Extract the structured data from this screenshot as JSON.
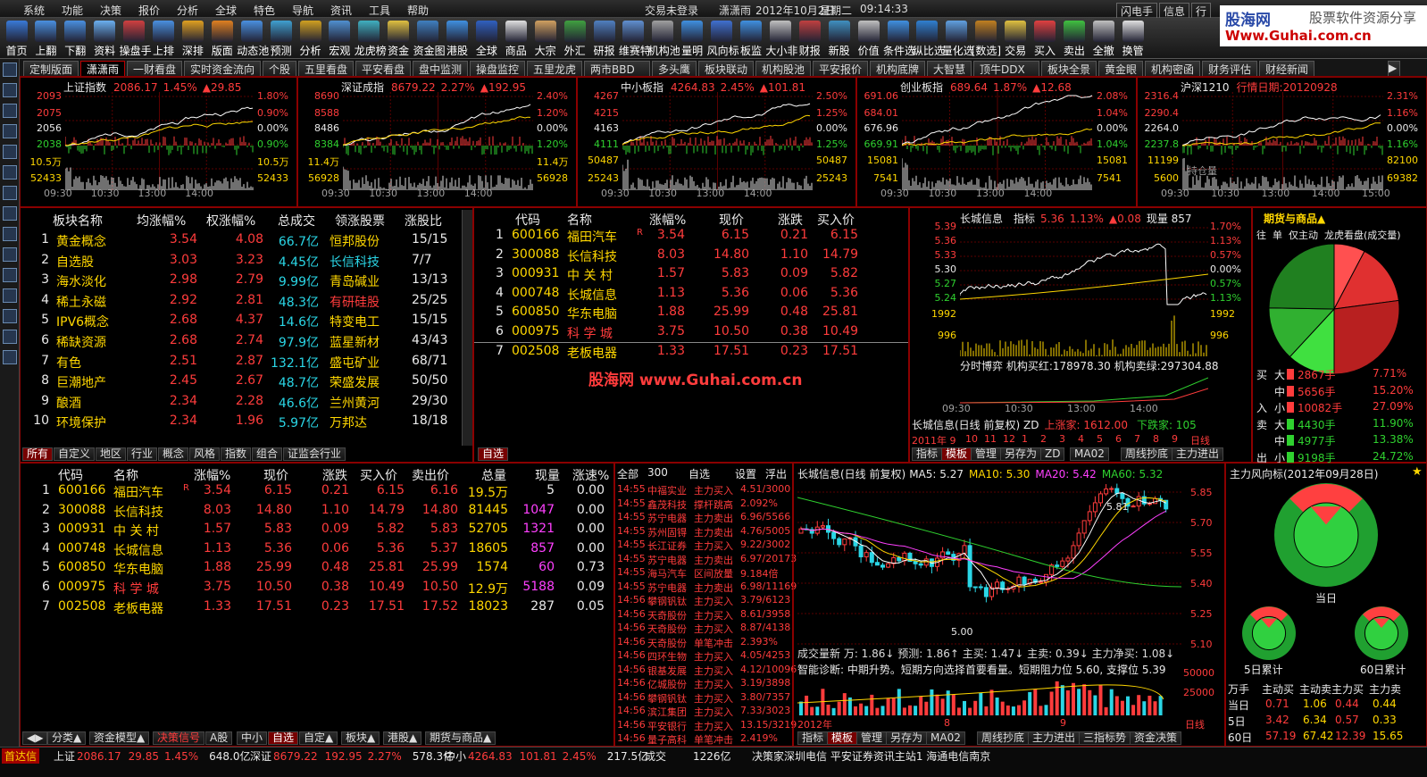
{
  "menu": {
    "items": [
      "系统",
      "功能",
      "决策",
      "报价",
      "分析",
      "全球",
      "特色",
      "导航",
      "资讯",
      "工具",
      "帮助"
    ],
    "login": "交易未登录",
    "user": "潇潇雨",
    "date": "2012年10月2日",
    "weekday": "星期二",
    "time": "09:14:33",
    "right": [
      "闪电手",
      "信息",
      "行"
    ]
  },
  "logo": {
    "t1": "股海网",
    "t2": "股票软件资源分享",
    "t3": "Www.Guhai.com.cn"
  },
  "toolbar": [
    {
      "l": "首页",
      "c": "#3a7ad8"
    },
    {
      "l": "上翻",
      "c": "#4a90e0"
    },
    {
      "l": "下翻",
      "c": "#4a90e0"
    },
    {
      "l": "资料",
      "c": "#6ab0f0"
    },
    {
      "l": "操盘手",
      "c": "#d04040"
    },
    {
      "l": "上排",
      "c": "#4a90e0"
    },
    {
      "l": "深排",
      "c": "#e0a020"
    },
    {
      "l": "版面",
      "c": "#e08020"
    },
    {
      "l": "动态池",
      "c": "#4a90e0"
    },
    {
      "l": "预测",
      "c": "#40a0d0"
    },
    {
      "l": "分析",
      "c": "#d0a020"
    },
    {
      "l": "宏观",
      "c": "#5090d0"
    },
    {
      "l": "龙虎榜",
      "c": "#40b0c0"
    },
    {
      "l": "资金",
      "c": "#e0c040"
    },
    {
      "l": "资金图",
      "c": "#4080c0"
    },
    {
      "l": "港股",
      "c": "#4090e0"
    },
    {
      "l": "全球",
      "c": "#3060c0"
    },
    {
      "l": "商品",
      "c": "#e0e0e0"
    },
    {
      "l": "大宗",
      "c": "#d0a060"
    },
    {
      "l": "外汇",
      "c": "#40a040"
    },
    {
      "l": "研报",
      "c": "#5080c0"
    },
    {
      "l": "维赛特",
      "c": "#6090d0"
    },
    {
      "l": "机构池",
      "c": "#a0a0a0"
    },
    {
      "l": "量明",
      "c": "#4090e0"
    },
    {
      "l": "风向标",
      "c": "#4070d0"
    },
    {
      "l": "板监",
      "c": "#4090e0"
    },
    {
      "l": "大小非",
      "c": "#c0c0c0"
    },
    {
      "l": "财报",
      "c": "#c04040"
    },
    {
      "l": "新股",
      "c": "#4090c0"
    },
    {
      "l": "价值",
      "c": "#c0c0c0"
    },
    {
      "l": "条件选",
      "c": "#4090e0"
    },
    {
      "l": "纵比选",
      "c": "#3080d0"
    },
    {
      "l": "量化选",
      "c": "#60a0e0"
    },
    {
      "l": "[数选]",
      "c": "#c08020"
    },
    {
      "l": "交易",
      "c": "#e0c040"
    },
    {
      "l": "买入",
      "c": "#e04040"
    },
    {
      "l": "卖出",
      "c": "#40c040"
    },
    {
      "l": "全撤",
      "c": "#c0c0c0"
    },
    {
      "l": "换管",
      "c": "#e0e0e0"
    }
  ],
  "tabs": [
    "定制版面",
    "潇潇雨",
    "一财看盘",
    "实时资金流向",
    "个股",
    "五里看盘",
    "平安看盘",
    "盘中监测",
    "操盘监控",
    "五里龙虎",
    "两市BBD",
    "多头鹰",
    "板块联动",
    "机构股池",
    "平安报价",
    "机构底牌",
    "大智慧",
    "顶牛DDX",
    "板块全景",
    "黄金眼",
    "机构密函",
    "财务评估",
    "财经新闻"
  ],
  "minis": [
    {
      "name": "上证指数",
      "v1": "2086.17",
      "v2": "1.45%",
      "v3": "▲29.85",
      "left": [
        "2093",
        "2075",
        "2056",
        "2038",
        "10.5万",
        "52433"
      ],
      "right": [
        "1.80%",
        "0.90%",
        "0.00%",
        "0.90%",
        "10.5万",
        "52433"
      ],
      "times": [
        "09:30",
        "10:30",
        "13:00",
        "14:00"
      ]
    },
    {
      "name": "深证成指",
      "v1": "8679.22",
      "v2": "2.27%",
      "v3": "▲192.95",
      "left": [
        "8690",
        "8588",
        "8486",
        "8384",
        "11.4万",
        "56928"
      ],
      "right": [
        "2.40%",
        "1.20%",
        "0.00%",
        "1.20%",
        "11.4万",
        "56928"
      ],
      "times": [
        "09:30",
        "10:30",
        "13:00",
        "14:00"
      ]
    },
    {
      "name": "中小板指",
      "v1": "4264.83",
      "v2": "2.45%",
      "v3": "▲101.81",
      "left": [
        "4267",
        "4215",
        "4163",
        "4111",
        "50487",
        "25243"
      ],
      "right": [
        "2.50%",
        "1.25%",
        "0.00%",
        "1.25%",
        "50487",
        "25243"
      ],
      "times": [
        "09:30",
        "10:30",
        "13:00",
        "14:00"
      ]
    },
    {
      "name": "创业板指",
      "v1": "689.64",
      "v2": "1.87%",
      "v3": "▲12.68",
      "left": [
        "691.06",
        "684.01",
        "676.96",
        "669.91",
        "15081",
        "7541"
      ],
      "right": [
        "2.08%",
        "1.04%",
        "0.00%",
        "1.04%",
        "15081",
        "7541"
      ],
      "times": [
        "09:30",
        "10:30",
        "13:00",
        "14:00"
      ]
    },
    {
      "name": "沪深1210",
      "v1": "行情日期:20120928",
      "v2": "",
      "v3": "",
      "left": [
        "2316.4",
        "2290.4",
        "2264.0",
        "2237.8",
        "11199",
        "5600"
      ],
      "right": [
        "2.31%",
        "1.16%",
        "0.00%",
        "1.16%",
        "82100",
        "69382"
      ],
      "times": [
        "09:30",
        "10:30",
        "13:00",
        "14:00",
        "15:00"
      ],
      "extra": "持仓量"
    }
  ],
  "sectors": {
    "headers": [
      "板块名称",
      "均涨幅%",
      "权涨幅%",
      "总成交",
      "领涨股票",
      "涨股比"
    ],
    "rows": [
      [
        "1",
        "黄金概念",
        "3.54",
        "4.08",
        "66.7亿",
        "恒邦股份",
        "15/15"
      ],
      [
        "2",
        "自选股",
        "3.03",
        "3.23",
        "4.45亿",
        "长信科技",
        "7/7"
      ],
      [
        "3",
        "海水淡化",
        "2.98",
        "2.79",
        "9.99亿",
        "青岛碱业",
        "13/13"
      ],
      [
        "4",
        "稀土永磁",
        "2.92",
        "2.81",
        "48.3亿",
        "有研硅股",
        "25/25"
      ],
      [
        "5",
        "IPV6概念",
        "2.68",
        "4.37",
        "14.6亿",
        "特变电工",
        "15/15"
      ],
      [
        "6",
        "稀缺资源",
        "2.68",
        "2.74",
        "97.9亿",
        "蓝星新材",
        "43/43"
      ],
      [
        "7",
        "有色",
        "2.51",
        "2.87",
        "132.1亿",
        "盛屯矿业",
        "68/71"
      ],
      [
        "8",
        "巨潮地产",
        "2.45",
        "2.67",
        "48.7亿",
        "荣盛发展",
        "50/50"
      ],
      [
        "9",
        "酿酒",
        "2.34",
        "2.28",
        "46.6亿",
        "兰州黄河",
        "29/30"
      ],
      [
        "10",
        "环境保护",
        "2.34",
        "1.96",
        "5.97亿",
        "万邦达",
        "18/18"
      ]
    ],
    "btabs": [
      "所有",
      "自定义",
      "地区",
      "行业",
      "概念",
      "风格",
      "指数",
      "组合",
      "证监会行业"
    ]
  },
  "watch": {
    "headers": [
      "代码",
      "名称",
      "涨幅%",
      "现价",
      "涨跌",
      "买入价"
    ],
    "rows": [
      [
        "1",
        "600166",
        "福田汽车",
        "R",
        "3.54",
        "6.15",
        "0.21",
        "6.15"
      ],
      [
        "2",
        "300088",
        "长信科技",
        "",
        "8.03",
        "14.80",
        "1.10",
        "14.79"
      ],
      [
        "3",
        "000931",
        "中 关 村",
        "",
        "1.57",
        "5.83",
        "0.09",
        "5.82"
      ],
      [
        "4",
        "000748",
        "长城信息",
        "",
        "1.13",
        "5.36",
        "0.06",
        "5.36"
      ],
      [
        "5",
        "600850",
        "华东电脑",
        "",
        "1.88",
        "25.99",
        "0.48",
        "25.81"
      ],
      [
        "6",
        "000975",
        "科 学 城",
        "",
        "3.75",
        "10.50",
        "0.38",
        "10.49"
      ],
      [
        "7",
        "002508",
        "老板电器",
        "",
        "1.33",
        "17.51",
        "0.23",
        "17.51"
      ]
    ],
    "watermark": "股海网  www.Guhai.com.cn",
    "tab": "自选"
  },
  "intra": {
    "name": "长城信息",
    "label": "指标",
    "price": "5.36",
    "pct": "1.13%",
    "chg": "▲0.08",
    "vol": "现量 857",
    "left": [
      "5.39",
      "5.36",
      "5.33",
      "5.30",
      "5.27",
      "5.24",
      "1992",
      "996"
    ],
    "right": [
      "1.70%",
      "1.13%",
      "0.57%",
      "0.00%",
      "0.57%",
      "1.13%",
      "1992",
      "996"
    ],
    "bottom": "分时博弈  机构买红:178978.30  机构卖绿:297304.88",
    "times": [
      "09:30",
      "10:30",
      "13:00",
      "14:00"
    ],
    "btabs": [
      "指标",
      "模板",
      "管理",
      "另存为",
      "ZD",
      "MA02",
      "周线抄底",
      "主力进出"
    ],
    "daily": {
      "title": "长城信息(日线 前复权) ZD",
      "up": "上涨家: 1612.00",
      "down": "下跌家: 105",
      "years": [
        "2011年 9",
        "10",
        "11",
        "12",
        "1",
        "2",
        "3",
        "4",
        "5",
        "6",
        "7",
        "8",
        "9",
        "日线"
      ]
    }
  },
  "futures": {
    "title": "期货与商品▲",
    "tabs": [
      "往",
      "单",
      "仅主动",
      "龙虎看盘(成交量)"
    ],
    "rows": [
      [
        "买",
        "大",
        "2867手",
        "7.71%"
      ],
      [
        "",
        "中",
        "5656手",
        "15.20%"
      ],
      [
        "入",
        "小",
        "10082手",
        "27.09%"
      ],
      [
        "卖",
        "大",
        "4430手",
        "11.90%"
      ],
      [
        "",
        "中",
        "4977手",
        "13.38%"
      ],
      [
        "出",
        "小",
        "9198手",
        "24.72%"
      ]
    ]
  },
  "quotes": {
    "headers": [
      "代码",
      "名称",
      "涨幅%",
      "现价",
      "涨跌",
      "买入价",
      "卖出价",
      "总量",
      "现量",
      "涨速%"
    ],
    "rows": [
      [
        "1",
        "600166",
        "福田汽车",
        "R",
        "3.54",
        "6.15",
        "0.21",
        "6.15",
        "6.16",
        "19.5万",
        "5",
        "0.00"
      ],
      [
        "2",
        "300088",
        "长信科技",
        "",
        "8.03",
        "14.80",
        "1.10",
        "14.79",
        "14.80",
        "81445",
        "1047",
        "0.00"
      ],
      [
        "3",
        "000931",
        "中 关 村",
        "",
        "1.57",
        "5.83",
        "0.09",
        "5.82",
        "5.83",
        "52705",
        "1321",
        "0.00"
      ],
      [
        "4",
        "000748",
        "长城信息",
        "",
        "1.13",
        "5.36",
        "0.06",
        "5.36",
        "5.37",
        "18605",
        "857",
        "0.00"
      ],
      [
        "5",
        "600850",
        "华东电脑",
        "",
        "1.88",
        "25.99",
        "0.48",
        "25.81",
        "25.99",
        "1574",
        "60",
        "0.73"
      ],
      [
        "6",
        "000975",
        "科 学 城",
        "",
        "3.75",
        "10.50",
        "0.38",
        "10.49",
        "10.50",
        "12.9万",
        "5188",
        "0.09"
      ],
      [
        "7",
        "002508",
        "老板电器",
        "",
        "1.33",
        "17.51",
        "0.23",
        "17.51",
        "17.52",
        "18023",
        "287",
        "0.05"
      ]
    ],
    "btabs": [
      "分类▲",
      "资金模型▲",
      "决策信号",
      "A股",
      "中小",
      "自选",
      "自定▲",
      "板块▲",
      "港股▲",
      "期货与商品▲"
    ]
  },
  "feed": {
    "tabs": [
      "全部",
      "300",
      "自选",
      "设置",
      "浮出"
    ],
    "rows": [
      [
        "14:55",
        "中福实业",
        "主力买入",
        "4.51/3000"
      ],
      [
        "14:55",
        "鑫茂科技",
        "撑杆跳高",
        "2.092%"
      ],
      [
        "14:55",
        "苏宁电器",
        "主力卖出",
        "6.96/5566"
      ],
      [
        "14:55",
        "苏州固锝",
        "主力卖出",
        "4.76/5005"
      ],
      [
        "14:55",
        "长江证券",
        "主力买入",
        "9.22/3002"
      ],
      [
        "14:55",
        "苏宁电器",
        "主力卖出",
        "6.97/20173"
      ],
      [
        "14:55",
        "海马汽车",
        "区间放量",
        "9.184倍"
      ],
      [
        "14:55",
        "苏宁电器",
        "主力卖出",
        "6.98/11169"
      ],
      [
        "14:56",
        "攀钢钒钛",
        "主力买入",
        "3.79/6123"
      ],
      [
        "14:56",
        "天奇股份",
        "主力买入",
        "8.61/3958"
      ],
      [
        "14:56",
        "天奇股份",
        "主力买入",
        "8.87/4138"
      ],
      [
        "14:56",
        "天奇股份",
        "单笔冲击",
        "2.393%"
      ],
      [
        "14:56",
        "四环生物",
        "主力买入",
        "4.05/4253"
      ],
      [
        "14:56",
        "银基发展",
        "主力买入",
        "4.12/10096"
      ],
      [
        "14:56",
        "亿城股份",
        "主力买入",
        "3.19/3898"
      ],
      [
        "14:56",
        "攀钢钒钛",
        "主力买入",
        "3.80/7357"
      ],
      [
        "14:56",
        "滨江集团",
        "主力买入",
        "7.33/3023"
      ],
      [
        "14:56",
        "平安银行",
        "主力买入",
        "13.15/3219"
      ],
      [
        "14:56",
        "量子高科",
        "单笔冲击",
        "2.419%"
      ]
    ]
  },
  "kline": {
    "title": "长城信息(日线 前复权)",
    "ma5": "MA5: 5.27",
    "ma10": "MA10: 5.30",
    "ma20": "MA20: 5.42",
    "ma60": "MA60: 5.32",
    "prices": [
      "5.85",
      "5.70",
      "5.55",
      "5.40",
      "5.25",
      "5.10"
    ],
    "high": "5.81",
    "low": "5.00",
    "vline": "成交量新  万: 1.86↓  预测: 1.86↑  主买: 1.47↓  主卖: 0.39↓  主力净买: 1.08↓",
    "diag": "智能诊断: 中期升势。短期方向选择首要看量。短期阻力位 5.60, 支撑位 5.39",
    "vscale": [
      "50000",
      "25000"
    ],
    "dates": [
      "2012年",
      "8",
      "9",
      "日线"
    ],
    "btabs": [
      "指标",
      "模板",
      "管理",
      "另存为",
      "MA02",
      "周线抄底",
      "主力进出",
      "三指标势",
      "资金决策"
    ]
  },
  "risk": {
    "title": "主力风向标(2012年09月28日)",
    "today": "当日",
    "d5": "5日累计",
    "d60": "60日累计",
    "headers": [
      "万手",
      "主动买",
      "主动卖",
      "主力买",
      "主力卖"
    ],
    "rows": [
      [
        "当日",
        "0.71",
        "1.06",
        "0.44",
        "0.44"
      ],
      [
        "5日",
        "3.42",
        "6.34",
        "0.57",
        "0.33"
      ],
      [
        "60日",
        "57.19",
        "67.42",
        "12.39",
        "15.65"
      ]
    ]
  },
  "status": {
    "items": [
      [
        "上证",
        "2086.17",
        "29.85",
        "1.45%",
        "648.0亿"
      ],
      [
        "深证",
        "8679.22",
        "192.95",
        "2.27%",
        "578.3亿"
      ],
      [
        "中小",
        "4264.83",
        "101.81",
        "2.45%",
        "217.5亿"
      ]
    ],
    "deal": "成交",
    "dealv": "1226亿",
    "left": "首达信",
    "news": "决策家深圳电信  平安证券资讯主站1  海通电信南京"
  },
  "colors": {
    "up": "#ff3c3c",
    "down": "#2fd12f",
    "frame": "#8b0000",
    "accent": "#ffd700"
  }
}
